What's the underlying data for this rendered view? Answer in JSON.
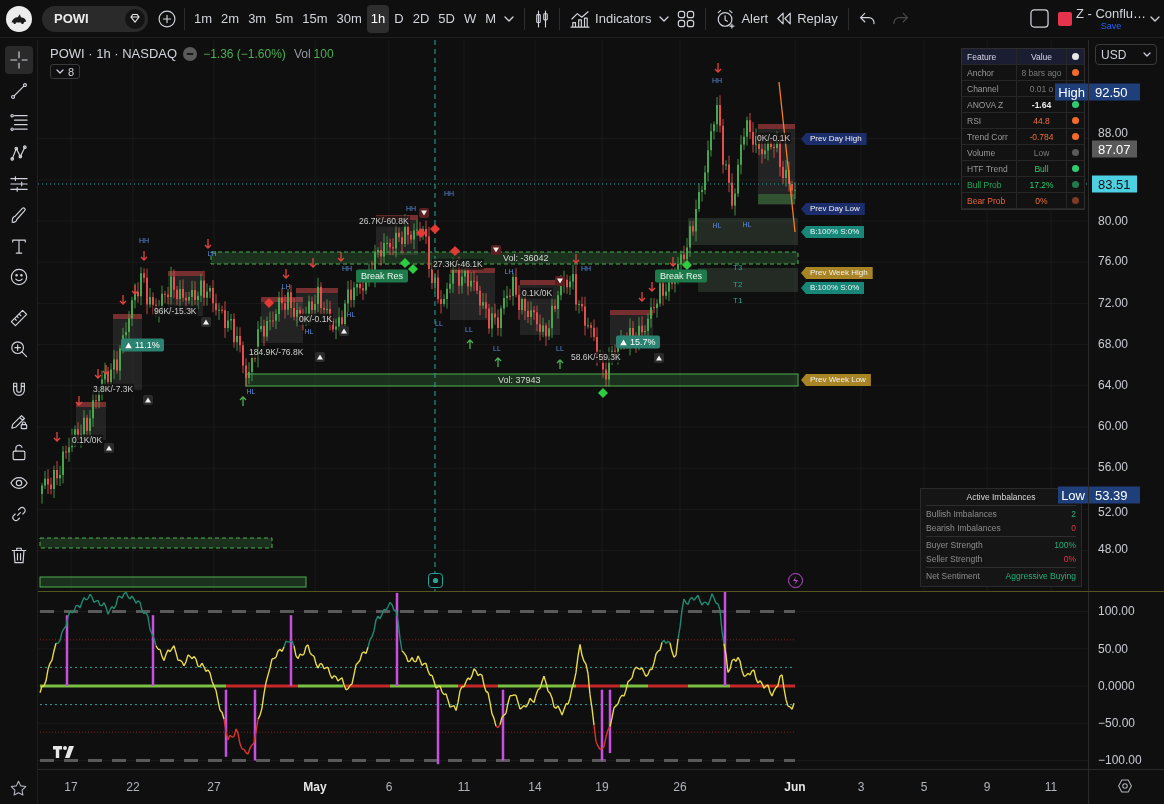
{
  "toolbar": {
    "symbol": "POWI",
    "intervals": [
      {
        "label": "1m",
        "selected": false
      },
      {
        "label": "2m",
        "selected": false
      },
      {
        "label": "3m",
        "selected": false
      },
      {
        "label": "5m",
        "selected": false
      },
      {
        "label": "15m",
        "selected": false
      },
      {
        "label": "30m",
        "selected": false
      },
      {
        "label": "1h",
        "selected": true
      },
      {
        "label": "D",
        "selected": false
      },
      {
        "label": "2D",
        "selected": false
      },
      {
        "label": "5D",
        "selected": false
      },
      {
        "label": "W",
        "selected": false
      },
      {
        "label": "M",
        "selected": false
      }
    ],
    "indicators": "Indicators",
    "alert": "Alert",
    "replay": "Replay",
    "undo": {
      "disabled": false
    },
    "redo": {
      "disabled": true
    },
    "layout": {
      "name": "Z - Conflu…",
      "action": "Save"
    }
  },
  "left_toolbar": {
    "tools": [
      {
        "selected": true
      },
      {
        "selected": false
      },
      {
        "selected": false
      },
      {
        "selected": false
      },
      {
        "selected": false
      },
      {
        "selected": false
      },
      {
        "selected": false
      },
      {
        "selected": false
      },
      {
        "selected": false
      },
      {
        "selected": false
      },
      {
        "selected": false
      },
      {
        "selected": false
      },
      {
        "selected": false
      },
      {
        "selected": false
      },
      {
        "selected": false
      },
      {
        "selected": false
      }
    ]
  },
  "legend": {
    "title": "POWI · 1h · NASDAQ",
    "change": "−1.36 (−1.60%)",
    "volume_label": "Vol",
    "volume": "100",
    "collapsed_count": "8"
  },
  "feature_table": {
    "columns": [
      "Feature",
      "Value"
    ],
    "rows": [
      {
        "feature": "Anchor",
        "value": "8 bars ago",
        "kind": "muted",
        "color": "#f26b2a"
      },
      {
        "feature": "Channel",
        "value": "0.01 o",
        "kind": "muted"
      },
      {
        "feature": "ANOVA Z",
        "value": "-1.64",
        "kind": "plain",
        "color": "#2ecc71"
      },
      {
        "feature": "RSI",
        "value": "44.8",
        "kind": "warning",
        "color": "#f26b2a"
      },
      {
        "feature": "Trend Corr",
        "value": "-0.784",
        "kind": "warning",
        "color": "#f26b2a"
      },
      {
        "feature": "Volume",
        "value": "Low",
        "kind": "muted",
        "color": "#5a5a5a"
      },
      {
        "feature": "HTF Trend",
        "value": "Bull",
        "kind": "positive",
        "color": "#2ecc71"
      },
      {
        "feature": "Bull Prob",
        "value": "17.2%",
        "kind": "bullish",
        "color": "#1f7a4c"
      },
      {
        "feature": "Bear Prob",
        "value": "0%",
        "kind": "bearish",
        "color": "#7d3a26"
      }
    ]
  },
  "imbalances": {
    "title": "Active Imbalances",
    "sections": [
      {
        "rows": [
          {
            "label": "Bullish Imbalances",
            "value": "2",
            "kind": "bull"
          },
          {
            "label": "Bearish Imbalances",
            "value": "0",
            "kind": "bear"
          }
        ]
      },
      {
        "rows": [
          {
            "label": "Buyer Strength",
            "value": "100%",
            "kind": "bull"
          },
          {
            "label": "Seller Strength",
            "value": "0%",
            "kind": "bear"
          }
        ]
      },
      {
        "rows": [
          {
            "label": "Net Sentiment",
            "value": "Aggressive Buying",
            "kind": "bull"
          }
        ]
      }
    ]
  },
  "price_axis": {
    "currency": "USD",
    "labels": [
      "88.00",
      "80.00",
      "76.00",
      "72.00",
      "68.00",
      "64.00",
      "60.00",
      "56.00",
      "52.00",
      "48.00"
    ],
    "tags": [
      {
        "kind": "high",
        "label": "High",
        "value": "92.50"
      },
      {
        "kind": "plain",
        "value": "87.07"
      },
      {
        "kind": "last",
        "value": "83.51"
      },
      {
        "kind": "low",
        "label": "Low",
        "value": "53.39"
      }
    ]
  },
  "chart_labels": [
    {
      "kind": "level_tag",
      "text": "Prev Day High",
      "color": "#1c2d6b"
    },
    {
      "kind": "level_tag",
      "text": "Prev Day Low",
      "color": "#1c2d6b"
    },
    {
      "kind": "level_tag",
      "text": "B:100% S:0%",
      "color": "#17877a"
    },
    {
      "kind": "level_tag",
      "text": "Prev Week High",
      "color": "#a88424"
    },
    {
      "kind": "level_tag",
      "text": "B:100% S:0%",
      "color": "#17877a"
    },
    {
      "kind": "level_tag",
      "text": "Prev Week Low",
      "color": "#a88424"
    },
    {
      "kind": "pill",
      "text": "Break Res"
    },
    {
      "kind": "pill",
      "text": "Break Res"
    },
    {
      "kind": "percent_pill",
      "text": "11.1%"
    },
    {
      "kind": "percent_pill",
      "text": "15.7%"
    },
    {
      "kind": "volume_text",
      "text": "0K/-0.1K"
    },
    {
      "kind": "volume_text",
      "text": "26.7K/-60.8K"
    },
    {
      "kind": "volume_text",
      "text": "27.3K/-46.1K"
    },
    {
      "kind": "volume_text",
      "text": "0.1K/0K"
    },
    {
      "kind": "volume_text",
      "text": "96K/-15.3K"
    },
    {
      "kind": "volume_text",
      "text": "0K/-0.1K"
    },
    {
      "kind": "volume_text",
      "text": "184.9K/-76.8K"
    },
    {
      "kind": "volume_text",
      "text": "58.6K/-59.3K"
    },
    {
      "kind": "volume_text",
      "text": "3.8K/-7.3K"
    },
    {
      "kind": "volume_text",
      "text": "0.1K/0K"
    },
    {
      "kind": "zone_text",
      "text": "Vol: -36042"
    },
    {
      "kind": "zone_text",
      "text": "Vol: 37943"
    },
    {
      "kind": "target",
      "text": "T3"
    },
    {
      "kind": "target",
      "text": "T2"
    },
    {
      "kind": "target",
      "text": "T1"
    },
    {
      "kind": "swing",
      "text": "HH"
    },
    {
      "kind": "swing",
      "text": "LH"
    },
    {
      "kind": "swing",
      "text": "HH"
    },
    {
      "kind": "swing",
      "text": "LH"
    },
    {
      "kind": "swing",
      "text": "LH"
    },
    {
      "kind": "swing",
      "text": "HH"
    },
    {
      "kind": "swing",
      "text": "HL"
    },
    {
      "kind": "swing",
      "text": "HL"
    },
    {
      "kind": "swing",
      "text": "LL"
    },
    {
      "kind": "swing",
      "text": "LL"
    },
    {
      "kind": "swing",
      "text": "LL"
    },
    {
      "kind": "swing",
      "text": "LL"
    },
    {
      "kind": "swing",
      "text": "HL"
    },
    {
      "kind": "swing",
      "text": "HL"
    },
    {
      "kind": "swing",
      "text": "HL"
    },
    {
      "kind": "swing",
      "text": "HH"
    },
    {
      "kind": "swing",
      "text": "HH"
    },
    {
      "kind": "swing",
      "text": "HH"
    }
  ],
  "oscillator": {
    "axis_labels": [
      "100.00",
      "50.00",
      "0.0000",
      "−50.00",
      "−100.00"
    ]
  },
  "time_axis": {
    "labels": [
      {
        "text": "17",
        "kind": "day"
      },
      {
        "text": "22",
        "kind": "day"
      },
      {
        "text": "27",
        "kind": "day"
      },
      {
        "text": "May",
        "kind": "month"
      },
      {
        "text": "6",
        "kind": "day"
      },
      {
        "text": "11",
        "kind": "day"
      },
      {
        "text": "14",
        "kind": "day"
      },
      {
        "text": "19",
        "kind": "day"
      },
      {
        "text": "26",
        "kind": "day"
      },
      {
        "text": "Jun",
        "kind": "month"
      },
      {
        "text": "3",
        "kind": "day"
      },
      {
        "text": "5",
        "kind": "day"
      },
      {
        "text": "9",
        "kind": "day"
      },
      {
        "text": "11",
        "kind": "day"
      }
    ]
  }
}
